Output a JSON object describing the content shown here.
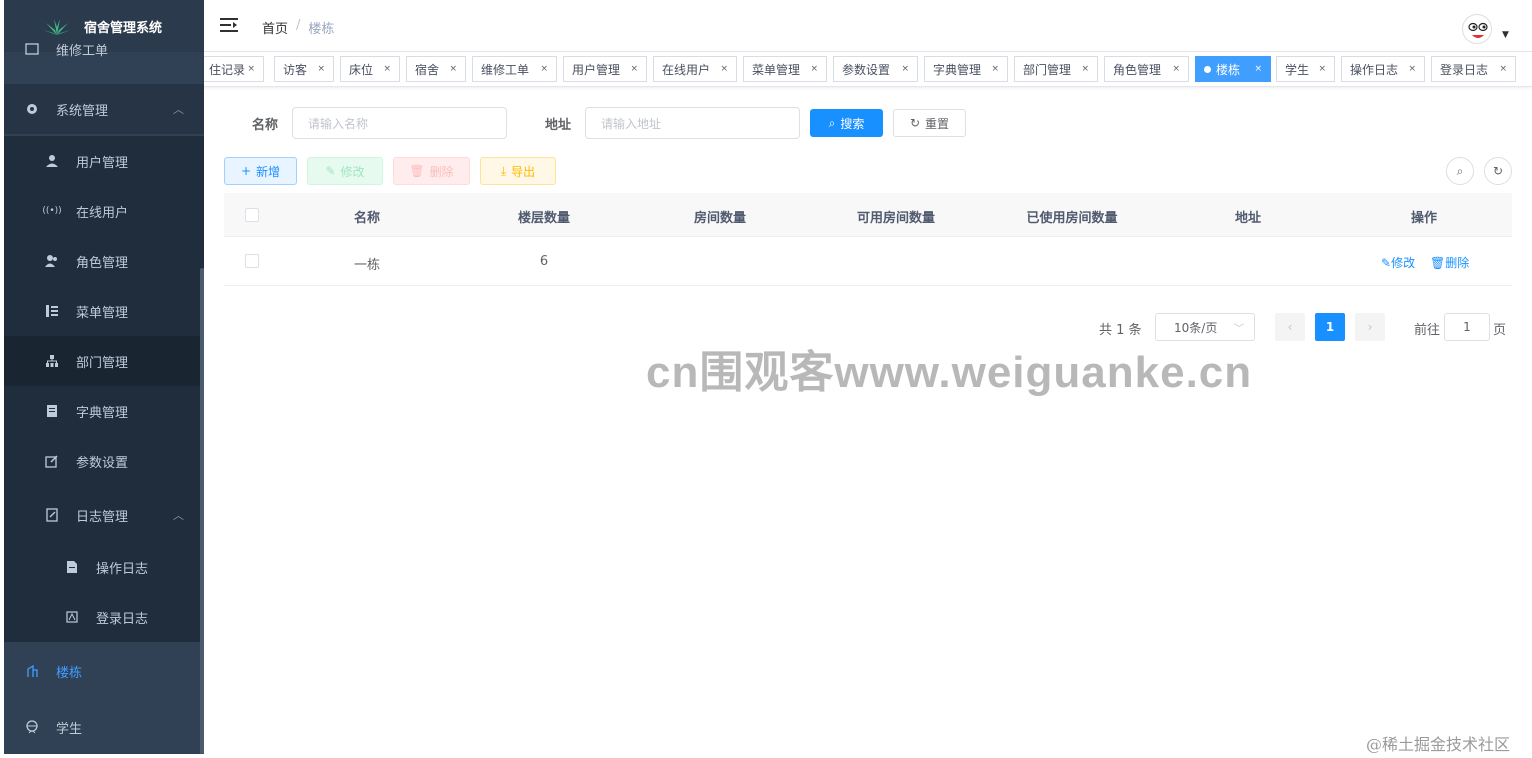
{
  "sidebar": {
    "logo_text": "宿舍管理系统",
    "items": {
      "repair": "维修工单",
      "system": "系统管理",
      "user": "用户管理",
      "online": "在线用户",
      "role": "角色管理",
      "menu": "菜单管理",
      "dept": "部门管理",
      "dict": "字典管理",
      "config": "参数设置",
      "log": "日志管理",
      "oper_log": "操作日志",
      "login_log": "登录日志",
      "building": "楼栋",
      "student": "学生"
    }
  },
  "navbar": {
    "breadcrumb_home": "首页",
    "breadcrumb_sep": "/",
    "breadcrumb_current": "楼栋"
  },
  "tags": [
    "住记录",
    "访客",
    "床位",
    "宿舍",
    "维修工单",
    "用户管理",
    "在线用户",
    "菜单管理",
    "参数设置",
    "字典管理",
    "部门管理",
    "角色管理",
    "楼栋",
    "学生",
    "操作日志",
    "登录日志"
  ],
  "tag_close": "×",
  "search": {
    "name_label": "名称",
    "name_placeholder": "请输入名称",
    "address_label": "地址",
    "address_placeholder": "请输入地址",
    "search_btn": "搜索",
    "reset_btn": "重置"
  },
  "toolbar": {
    "add": "新增",
    "edit": "修改",
    "delete": "删除",
    "export": "导出"
  },
  "table": {
    "headers": [
      "名称",
      "楼层数量",
      "房间数量",
      "可用房间数量",
      "已使用房间数量",
      "地址",
      "操作"
    ],
    "rows": [
      {
        "name": "一栋",
        "floors": "6",
        "rooms": "",
        "available": "",
        "used": "",
        "address": ""
      }
    ],
    "op_edit": "修改",
    "op_delete": "删除"
  },
  "pagination": {
    "total": "共 1 条",
    "page_size": "10条/页",
    "current": "1",
    "goto_prefix": "前往",
    "goto_value": "1",
    "goto_suffix": "页"
  },
  "watermark": "cn围观客www.weiguanke.cn",
  "corner_mark": "@稀土掘金技术社区",
  "colors": {
    "sidebar_bg": "#304156",
    "primary": "#1890ff",
    "active_tag": "#409eff"
  }
}
